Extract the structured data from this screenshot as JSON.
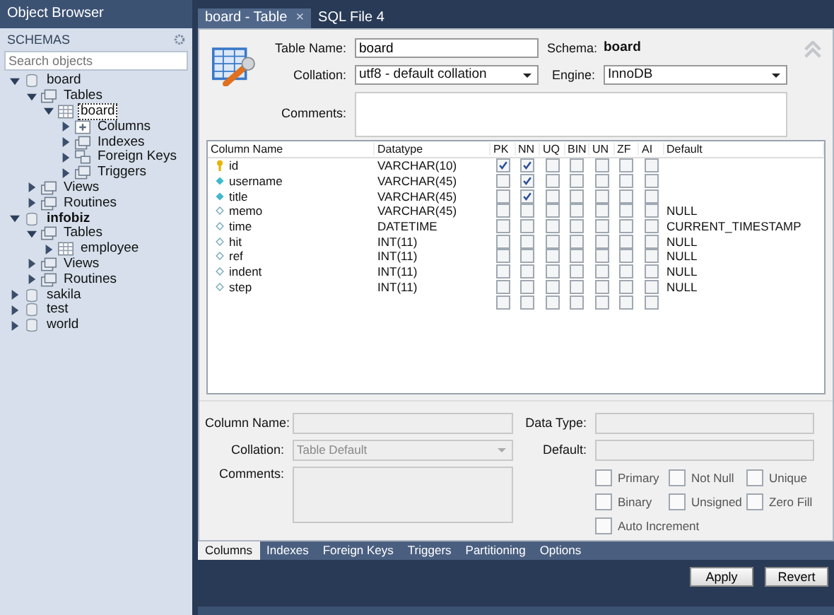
{
  "sidebar": {
    "title": "Object Browser",
    "section": "SCHEMAS",
    "search": {
      "placeholder": "Search objects"
    },
    "tree": [
      {
        "kind": "schema",
        "label": "board",
        "expanded": true,
        "selected": false,
        "default": false,
        "children": [
          {
            "kind": "folder",
            "label": "Tables",
            "expanded": true,
            "selected": false,
            "children": [
              {
                "kind": "table",
                "label": "board",
                "expanded": true,
                "selected": true,
                "children": [
                  {
                    "kind": "columns",
                    "label": "Columns",
                    "expanded": false,
                    "selected": false
                  },
                  {
                    "kind": "folder",
                    "label": "Indexes",
                    "expanded": false,
                    "selected": false
                  },
                  {
                    "kind": "keys",
                    "label": "Foreign Keys",
                    "expanded": false,
                    "selected": false
                  },
                  {
                    "kind": "folder",
                    "label": "Triggers",
                    "expanded": false,
                    "selected": false
                  }
                ]
              }
            ]
          },
          {
            "kind": "folder",
            "label": "Views",
            "expanded": false,
            "selected": false
          },
          {
            "kind": "folder",
            "label": "Routines",
            "expanded": false,
            "selected": false
          }
        ]
      },
      {
        "kind": "schema",
        "label": "infobiz",
        "expanded": true,
        "selected": false,
        "default": true,
        "children": [
          {
            "kind": "folder",
            "label": "Tables",
            "expanded": true,
            "selected": false,
            "children": [
              {
                "kind": "table",
                "label": "employee",
                "expanded": false,
                "selected": false
              }
            ]
          },
          {
            "kind": "folder",
            "label": "Views",
            "expanded": false,
            "selected": false
          },
          {
            "kind": "folder",
            "label": "Routines",
            "expanded": false,
            "selected": false
          }
        ]
      },
      {
        "kind": "schema",
        "label": "sakila",
        "expanded": false,
        "selected": false,
        "default": false
      },
      {
        "kind": "schema",
        "label": "test",
        "expanded": false,
        "selected": false,
        "default": false
      },
      {
        "kind": "schema",
        "label": "world",
        "expanded": false,
        "selected": false,
        "default": false
      }
    ]
  },
  "tabs": [
    {
      "label": "board - Table",
      "close": "×",
      "selected": true
    },
    {
      "label": "SQL File 4",
      "selected": false
    }
  ],
  "table_form": {
    "table_name_label": "Table Name:",
    "table_name": "board",
    "schema_label": "Schema:",
    "schema": "board",
    "collation_label": "Collation:",
    "collation": "utf8 - default collation",
    "engine_label": "Engine:",
    "engine": "InnoDB",
    "comments_label": "Comments:"
  },
  "grid": {
    "columns": [
      "Column Name",
      "Datatype",
      "PK",
      "NN",
      "UQ",
      "BIN",
      "UN",
      "ZF",
      "AI",
      "Default"
    ],
    "rows": [
      {
        "kind": "key",
        "name": "id",
        "datatype": "VARCHAR(10)",
        "flags": [
          true,
          true,
          false,
          false,
          false,
          false,
          false
        ]
      },
      {
        "kind": "notnull",
        "name": "username",
        "datatype": "VARCHAR(45)",
        "flags": [
          false,
          true,
          false,
          false,
          false,
          false,
          false
        ]
      },
      {
        "kind": "notnull",
        "name": "title",
        "datatype": "VARCHAR(45)",
        "flags": [
          false,
          true,
          false,
          false,
          false,
          false,
          false
        ]
      },
      {
        "kind": "plain",
        "name": "memo",
        "datatype": "VARCHAR(45)",
        "flags": [
          false,
          false,
          false,
          false,
          false,
          false,
          false
        ],
        "default": "NULL"
      },
      {
        "kind": "plain",
        "name": "time",
        "datatype": "DATETIME",
        "flags": [
          false,
          false,
          false,
          false,
          false,
          false,
          false
        ],
        "default": "CURRENT_TIMESTAMP"
      },
      {
        "kind": "plain",
        "name": "hit",
        "datatype": "INT(11)",
        "flags": [
          false,
          false,
          false,
          false,
          false,
          false,
          false
        ],
        "default": "NULL"
      },
      {
        "kind": "plain",
        "name": "ref",
        "datatype": "INT(11)",
        "flags": [
          false,
          false,
          false,
          false,
          false,
          false,
          false
        ],
        "default": "NULL"
      },
      {
        "kind": "plain",
        "name": "indent",
        "datatype": "INT(11)",
        "flags": [
          false,
          false,
          false,
          false,
          false,
          false,
          false
        ],
        "default": "NULL"
      },
      {
        "kind": "plain",
        "name": "step",
        "datatype": "INT(11)",
        "flags": [
          false,
          false,
          false,
          false,
          false,
          false,
          false
        ],
        "default": "NULL"
      },
      {
        "kind": "new",
        "flags": [
          false,
          false,
          false,
          false,
          false,
          false,
          false
        ]
      }
    ]
  },
  "column_form": {
    "column_name_label": "Column Name:",
    "collation_label": "Collation:",
    "collation": "Table Default",
    "comments_label": "Comments:",
    "data_type_label": "Data Type:",
    "default_label": "Default:",
    "options": [
      {
        "label": "Primary",
        "checked": false
      },
      {
        "label": "Not Null",
        "checked": false
      },
      {
        "label": "Unique",
        "checked": false
      },
      {
        "label": "Binary",
        "checked": false
      },
      {
        "label": "Unsigned",
        "checked": false
      },
      {
        "label": "Zero Fill",
        "checked": false
      },
      {
        "label": "Auto Increment",
        "checked": false
      }
    ]
  },
  "bottom_tabs": [
    {
      "label": "Columns",
      "selected": true
    },
    {
      "label": "Indexes",
      "selected": false
    },
    {
      "label": "Foreign Keys",
      "selected": false
    },
    {
      "label": "Triggers",
      "selected": false
    },
    {
      "label": "Partitioning",
      "selected": false
    },
    {
      "label": "Options",
      "selected": false
    }
  ],
  "buttons": [
    "Apply",
    "Revert"
  ]
}
